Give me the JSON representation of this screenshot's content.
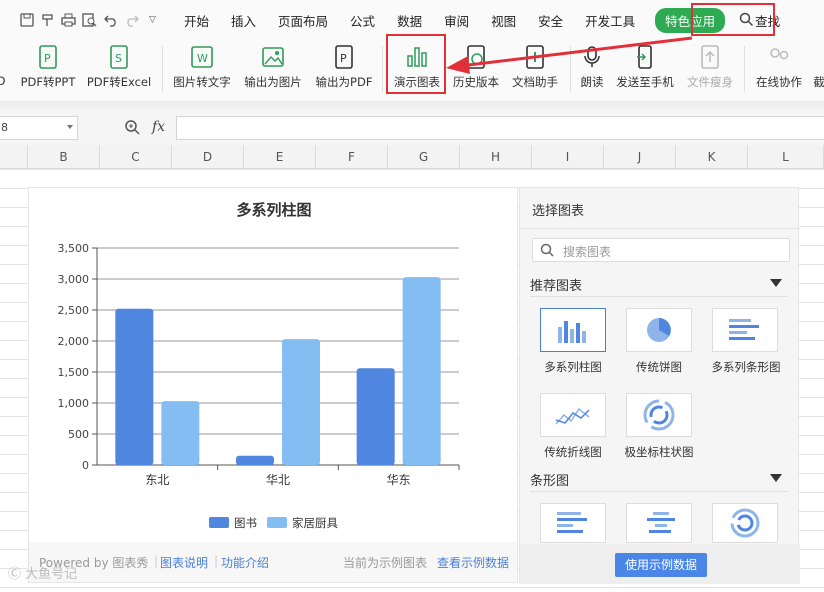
{
  "menu": {
    "tabs": [
      "开始",
      "插入",
      "页面布局",
      "公式",
      "数据",
      "审阅",
      "视图",
      "安全",
      "开发工具"
    ],
    "special_tab": "特色应用",
    "search_label": "查找"
  },
  "toolbar": {
    "items": [
      "PDF转PPT",
      "PDF转Excel",
      "图片转文字",
      "输出为图片",
      "输出为PDF",
      "演示图表",
      "历史版本",
      "文档助手",
      "朗读",
      "发送至手机",
      "文件瘦身",
      "在线协作"
    ]
  },
  "formula_bar": {
    "cell_ref": "8",
    "fx": "fx"
  },
  "columns": [
    "B",
    "C",
    "D",
    "E",
    "F",
    "G",
    "H",
    "I",
    "J",
    "K",
    "L"
  ],
  "chart_data": {
    "type": "bar",
    "title": "多系列柱图",
    "categories": [
      "东北",
      "华北",
      "华东"
    ],
    "series": [
      {
        "name": "图书",
        "values": [
          2520,
          150,
          1560
        ],
        "color": "#4f86e0"
      },
      {
        "name": "家居厨具",
        "values": [
          1030,
          2030,
          3030
        ],
        "color": "#84bdf2"
      }
    ],
    "ylim": [
      0,
      3500
    ],
    "yticks": [
      "0",
      "500",
      "1,000",
      "1,500",
      "2,000",
      "2,500",
      "3,000",
      "3,500"
    ],
    "legend": "bottom",
    "grid": true
  },
  "chart_footer": {
    "powered": "Powered by 图表秀",
    "help": "图表说明",
    "intro": "功能介绍",
    "current": "当前为示例图表",
    "view": "查看示例数据"
  },
  "panel": {
    "title": "选择图表",
    "search_placeholder": "搜索图表",
    "recommended": "推荐图表",
    "bar_section": "条形图",
    "charts": [
      "多系列柱图",
      "传统饼图",
      "多系列条形图",
      "传统折线图",
      "极坐标柱状图"
    ],
    "use_button": "使用示例数据"
  },
  "watermark": "大鱼号记"
}
